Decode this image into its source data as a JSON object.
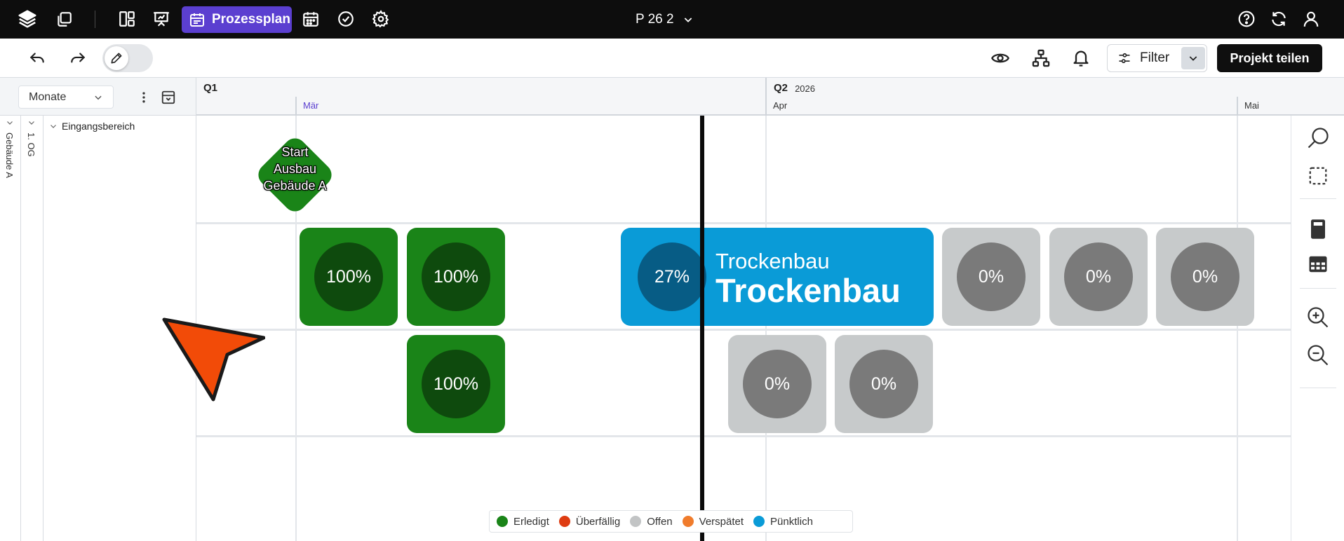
{
  "topbar": {
    "active_view_label": "Prozessplan",
    "project_title": "P 26 2"
  },
  "toolbar": {
    "filter_label": "Filter",
    "share_label": "Projekt teilen"
  },
  "left_header": {
    "scale_select": "Monate"
  },
  "timeline": {
    "quarters": [
      {
        "label": "Q1",
        "year": "2026"
      },
      {
        "label": "Q2"
      }
    ],
    "months": [
      "Mär",
      "Apr",
      "Mai"
    ]
  },
  "tree": {
    "building": "Gebäude A",
    "floor": "1. OG",
    "area": "Eingangsbereich"
  },
  "milestone": {
    "label_lines": [
      "Start",
      "Ausbau",
      "Gebäude A"
    ]
  },
  "tasks": {
    "row1": [
      "100%",
      "100%",
      "0%",
      "0%",
      "0%"
    ],
    "row2": [
      "100%",
      "0%",
      "0%"
    ],
    "active": {
      "percent": "27%",
      "subtitle": "Trockenbau",
      "title": "Trockenbau"
    }
  },
  "legend": [
    {
      "label": "Erledigt",
      "color": "#1a8418"
    },
    {
      "label": "Überfällig",
      "color": "#de3c12"
    },
    {
      "label": "Offen",
      "color": "#c2c4c5"
    },
    {
      "label": "Verspätet",
      "color": "#f07c2c"
    },
    {
      "label": "Pünktlich",
      "color": "#0a9bd7"
    }
  ],
  "colors": {
    "topbar": "#0d0d0d",
    "accent": "#5b3fd0",
    "done": "#1a8418",
    "open": "#c7cacb",
    "on_time": "#0a9bd7"
  },
  "icons": [
    "layers-icon",
    "copy-icon",
    "layout-icon",
    "presentation-icon",
    "calendar-icon",
    "check-circle-icon",
    "gear-icon",
    "help-icon",
    "sync-icon",
    "user-icon",
    "undo-icon",
    "redo-icon",
    "pencil-icon",
    "eye-icon",
    "hierarchy-icon",
    "bell-icon",
    "sliders-icon",
    "chevron-down-icon",
    "more-vert-icon",
    "archive-icon",
    "search-icon",
    "select-area-icon",
    "calculator-icon",
    "table-icon",
    "zoom-in-icon",
    "zoom-out-icon"
  ]
}
